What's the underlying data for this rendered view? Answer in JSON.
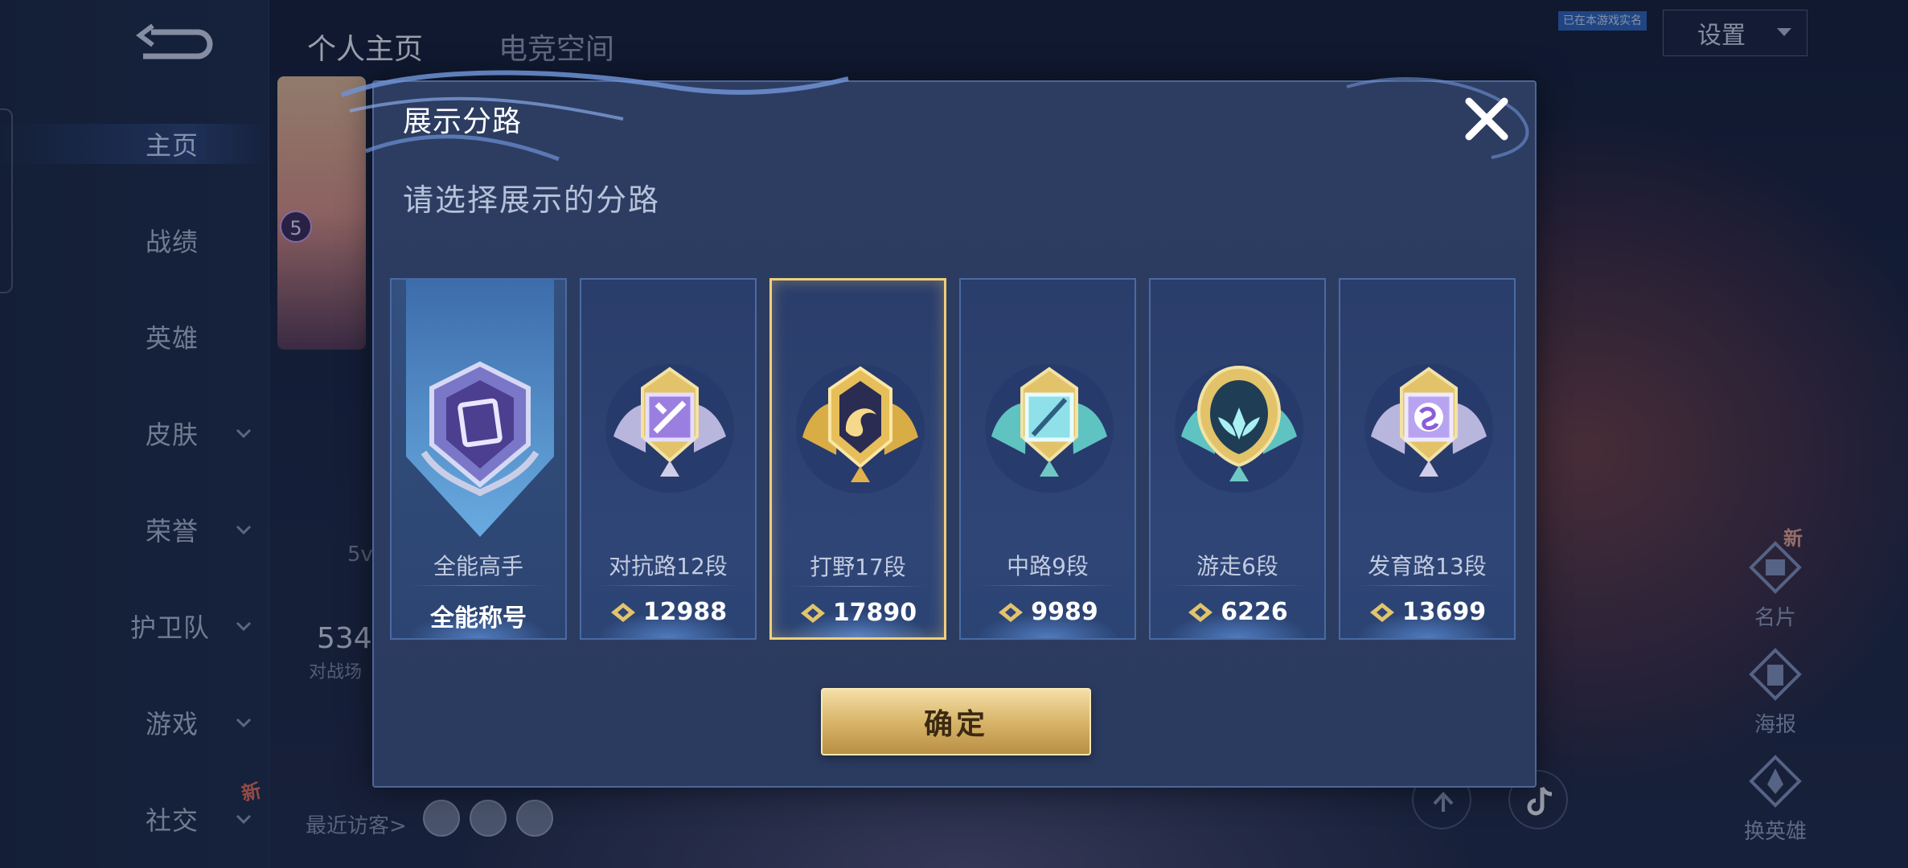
{
  "sidebar": {
    "items": [
      {
        "label": "主页",
        "active": true
      },
      {
        "label": "战绩"
      },
      {
        "label": "英雄"
      },
      {
        "label": "皮肤"
      },
      {
        "label": "荣誉"
      },
      {
        "label": "护卫队"
      },
      {
        "label": "游戏"
      },
      {
        "label": "社交"
      }
    ],
    "new_badge": "新"
  },
  "header": {
    "tabs": [
      {
        "label": "个人主页",
        "active": true
      },
      {
        "label": "电竞空间"
      }
    ],
    "settings_label": "设置",
    "verify_tag": "已在本游戏实名"
  },
  "profile_bg": {
    "level": "5",
    "stat_small": "5v",
    "stat_number": "534",
    "stat_caption": "对战场",
    "recent_visitors_label": "最近访客>"
  },
  "right_actions": {
    "new_badge": "新",
    "items": [
      {
        "label": "名片",
        "icon": "card-icon"
      },
      {
        "label": "海报",
        "icon": "poster-icon"
      },
      {
        "label": "换英雄",
        "icon": "swap-hero-icon"
      }
    ]
  },
  "modal": {
    "title": "展示分路",
    "subtitle": "请选择展示的分路",
    "confirm_label": "确定",
    "cards": [
      {
        "name": "全能高手",
        "value": "全能称号",
        "icon": "all-round-badge-icon",
        "selected": false
      },
      {
        "name": "对抗路12段",
        "value": "12988",
        "icon": "clash-lane-badge-icon",
        "selected": false
      },
      {
        "name": "打野17段",
        "value": "17890",
        "icon": "jungle-badge-icon",
        "selected": true
      },
      {
        "name": "中路9段",
        "value": "9989",
        "icon": "mid-lane-badge-icon",
        "selected": false
      },
      {
        "name": "游走6段",
        "value": "6226",
        "icon": "roam-badge-icon",
        "selected": false
      },
      {
        "name": "发育路13段",
        "value": "13699",
        "icon": "farm-lane-badge-icon",
        "selected": false
      }
    ]
  },
  "colors": {
    "modal_bg": "#2d3d62",
    "card_border": "#4a6aa3",
    "selected_border": "#f0cf79",
    "gold_button": "#d8b56a",
    "silver_badge": "#8f8fd8",
    "gold_badge": "#e5b94b",
    "teal_badge": "#5fc3c1"
  }
}
